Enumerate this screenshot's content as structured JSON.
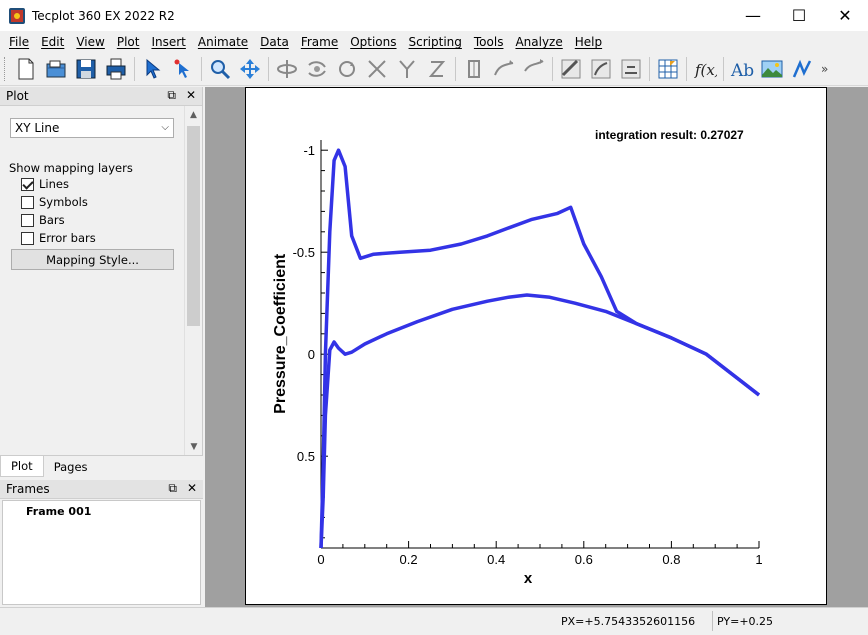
{
  "window": {
    "title": "Tecplot 360 EX 2022 R2",
    "controls": {
      "minimize": "—",
      "maximize": "☐",
      "close": "✕"
    }
  },
  "menu": [
    "File",
    "Edit",
    "View",
    "Plot",
    "Insert",
    "Animate",
    "Data",
    "Frame",
    "Options",
    "Scripting",
    "Tools",
    "Analyze",
    "Help"
  ],
  "toolbar": {
    "more": "»",
    "icons": [
      "new-file-icon",
      "open-file-icon",
      "save-icon",
      "print-icon",
      "select-arrow-icon",
      "adjustor-icon",
      "zoom-icon",
      "translate-icon",
      "rotate-icon",
      "rotate-xy-icon",
      "spin-icon",
      "rotate-x-icon",
      "rotate-y-icon",
      "rotate-z-icon",
      "probe-icon",
      "streamtrace-icon",
      "contour-icon",
      "slice-icon",
      "isosurface-icon",
      "iso-icon",
      "grid-icon",
      "function-icon",
      "text-icon",
      "image-icon",
      "polyline-icon"
    ]
  },
  "plot_panel": {
    "header": "Plot",
    "plot_type": "XY Line",
    "show_layers_label": "Show mapping layers",
    "layers": [
      {
        "label": "Lines",
        "checked": true
      },
      {
        "label": "Symbols",
        "checked": false
      },
      {
        "label": "Bars",
        "checked": false
      },
      {
        "label": "Error bars",
        "checked": false
      }
    ],
    "mapping_style_button": "Mapping Style...",
    "tabs": [
      "Plot",
      "Pages"
    ]
  },
  "frames_panel": {
    "header": "Frames",
    "items": [
      "Frame 001"
    ]
  },
  "status": {
    "px": "PX=+5.7543352601156",
    "py": "PY=+0.25"
  },
  "chart_data": {
    "type": "line",
    "xlabel": "x",
    "ylabel": "Pressure_Coefficient",
    "annotation": "integration result: 0.27027",
    "xlim": [
      0,
      1
    ],
    "ylim_reversed": [
      0.95,
      -1.05
    ],
    "xticks": [
      "0",
      "0.2",
      "0.4",
      "0.6",
      "0.8",
      "1"
    ],
    "yticks": [
      "-1",
      "-0.5",
      "0",
      "0.5"
    ],
    "ytick_values": [
      -1,
      -0.5,
      0,
      0.5
    ],
    "xtick_values": [
      0,
      0.2,
      0.4,
      0.6,
      0.8,
      1
    ],
    "line_color": "#3333e6",
    "series": [
      {
        "x": [
          0,
          0.005,
          0.01,
          0.02,
          0.03,
          0.04,
          0.055,
          0.07,
          0.09,
          0.12,
          0.18,
          0.25,
          0.32,
          0.38,
          0.43,
          0.48,
          0.54,
          0.57,
          0.6,
          0.64,
          0.675,
          0.72,
          0.8,
          0.88,
          0.94,
          1.0
        ],
        "y": [
          0.95,
          0.55,
          0.0,
          -0.6,
          -0.95,
          -1.0,
          -0.92,
          -0.58,
          -0.47,
          -0.49,
          -0.5,
          -0.51,
          -0.54,
          -0.58,
          -0.62,
          -0.66,
          -0.69,
          -0.72,
          -0.54,
          -0.38,
          -0.21,
          -0.15,
          -0.08,
          0.0,
          0.1,
          0.2
        ]
      },
      {
        "x": [
          0,
          0.005,
          0.01,
          0.02,
          0.03,
          0.04,
          0.055,
          0.07,
          0.1,
          0.15,
          0.22,
          0.3,
          0.38,
          0.43,
          0.47,
          0.52,
          0.58,
          0.65,
          0.72,
          0.8,
          0.88,
          0.94,
          1.0
        ],
        "y": [
          0.95,
          0.7,
          0.3,
          -0.02,
          -0.06,
          -0.03,
          0.0,
          -0.01,
          -0.05,
          -0.1,
          -0.16,
          -0.22,
          -0.26,
          -0.28,
          -0.29,
          -0.28,
          -0.25,
          -0.21,
          -0.15,
          -0.08,
          0.0,
          0.1,
          0.2
        ]
      }
    ]
  }
}
